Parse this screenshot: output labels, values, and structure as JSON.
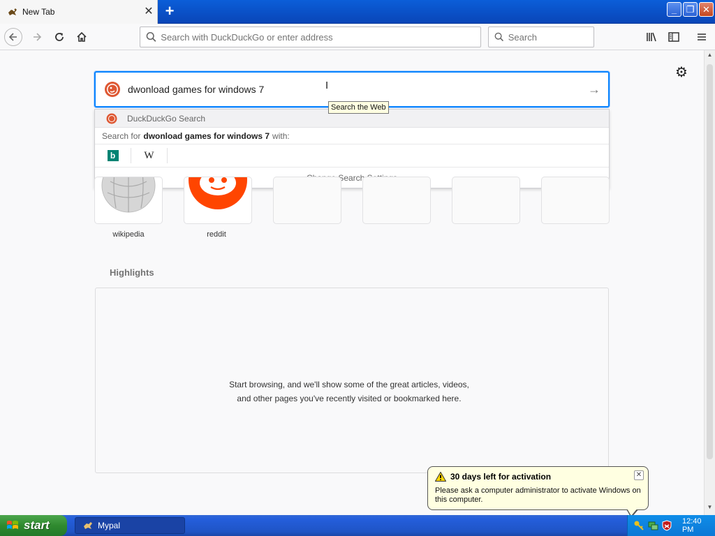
{
  "tab": {
    "title": "New Tab"
  },
  "toolbar": {
    "url_placeholder": "Search with DuckDuckGo or enter address",
    "search_placeholder": "Search"
  },
  "newtab_page": {
    "search_value": "dwonload games for windows 7",
    "tooltip": "Search the Web",
    "dropdown": {
      "engine_name": "DuckDuckGo Search",
      "search_for_prefix": "Search for",
      "search_for_query": "dwonload games for windows 7",
      "search_for_suffix": "with:",
      "change_settings": "Change Search Settings"
    },
    "top_sites": [
      {
        "label": "wikipedia"
      },
      {
        "label": "reddit"
      }
    ],
    "highlights": {
      "title": "Highlights",
      "empty_text": "Start browsing, and we'll show some of the great articles, videos, and other pages you've recently visited or bookmarked here."
    }
  },
  "balloon": {
    "title": "30 days left for activation",
    "body": "Please ask a computer administrator to activate Windows on this computer."
  },
  "taskbar": {
    "start_label": "start",
    "task_label": "Mypal",
    "clock": "12:40 PM"
  },
  "colors": {
    "accent": "#0a84ff",
    "xp_blue": "#245edb",
    "start_green": "#2f8a2f",
    "reddit_orange": "#ff4500",
    "duckduckgo_orange": "#de5833"
  },
  "icons": [
    "duck-favicon",
    "close-icon",
    "plus-icon",
    "back-icon",
    "forward-icon",
    "reload-icon",
    "home-icon",
    "search-icon",
    "library-icon",
    "sidebar-icon",
    "hamburger-icon",
    "gear-icon",
    "arrow-right-icon",
    "bing-icon",
    "wikipedia-icon",
    "reddit-icon",
    "warning-icon",
    "windows-flag-icon"
  ]
}
